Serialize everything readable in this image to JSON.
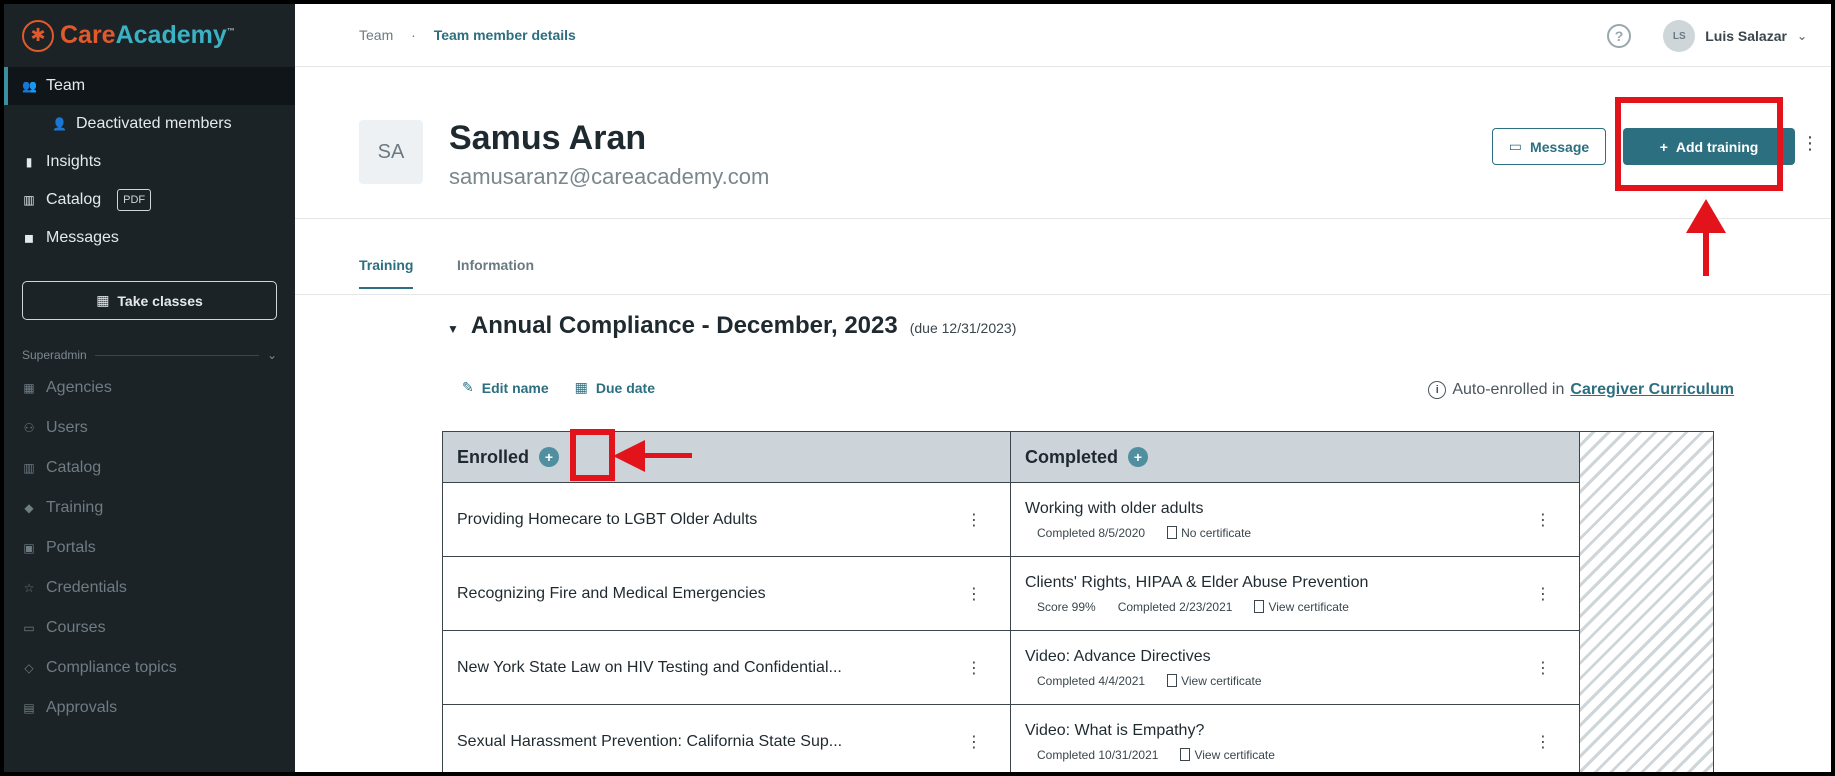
{
  "brand": {
    "care": "Care",
    "academy": "Academy",
    "tm": "™"
  },
  "sidebar": {
    "items": [
      {
        "label": "Team",
        "icon": "team-icon"
      },
      {
        "label": "Deactivated members",
        "icon": "user-minus-icon"
      },
      {
        "label": "Insights",
        "icon": "bar-chart-icon"
      },
      {
        "label": "Catalog",
        "icon": "book-icon",
        "tag": "PDF"
      },
      {
        "label": "Messages",
        "icon": "chat-icon"
      }
    ],
    "take_classes": "Take classes",
    "section_label": "Superadmin",
    "admin_items": [
      {
        "label": "Agencies",
        "icon": "building-icon"
      },
      {
        "label": "Users",
        "icon": "users-icon"
      },
      {
        "label": "Catalog",
        "icon": "book-icon"
      },
      {
        "label": "Training",
        "icon": "graduation-cap-icon"
      },
      {
        "label": "Portals",
        "icon": "portal-icon"
      },
      {
        "label": "Credentials",
        "icon": "star-icon"
      },
      {
        "label": "Courses",
        "icon": "book-open-icon"
      },
      {
        "label": "Compliance topics",
        "icon": "tag-icon"
      },
      {
        "label": "Approvals",
        "icon": "clipboard-icon"
      }
    ]
  },
  "topbar": {
    "breadcrumb": [
      "Team",
      "Team member details"
    ],
    "help": "?",
    "user": {
      "initials": "LS",
      "name": "Luis Salazar"
    }
  },
  "profile": {
    "initials": "SA",
    "name": "Samus Aran",
    "email": "samusaranz@careacademy.com",
    "message_label": "Message",
    "add_training_label": "Add training"
  },
  "tabs": [
    "Training",
    "Information"
  ],
  "section": {
    "title": "Annual Compliance - December, 2023",
    "due": "(due 12/31/2023)",
    "edit_name": "Edit name",
    "due_date": "Due date",
    "auto_enrolled_prefix": "Auto-enrolled in",
    "curriculum_link": "Caregiver Curriculum"
  },
  "board": {
    "enrolled_header": "Enrolled",
    "completed_header": "Completed",
    "enrolled": [
      "Providing Homecare to LGBT Older Adults",
      "Recognizing Fire and Medical Emergencies",
      "New York State Law on HIV Testing and Confidential...",
      "Sexual Harassment Prevention: California State Sup..."
    ],
    "completed": [
      {
        "title": "Working with older adults",
        "score": "",
        "completed": "Completed 8/5/2020",
        "cert": "No certificate"
      },
      {
        "title": "Clients' Rights, HIPAA & Elder Abuse Prevention",
        "score": "Score 99%",
        "completed": "Completed 2/23/2021",
        "cert": "View certificate"
      },
      {
        "title": "Video: Advance Directives",
        "score": "",
        "completed": "Completed 4/4/2021",
        "cert": "View certificate"
      },
      {
        "title": "Video: What is Empathy?",
        "score": "",
        "completed": "Completed 10/31/2021",
        "cert": "View certificate"
      }
    ]
  },
  "colors": {
    "accent": "#2c6f80",
    "sidebar_bg": "#1b2327",
    "annotation": "#e3131c"
  }
}
